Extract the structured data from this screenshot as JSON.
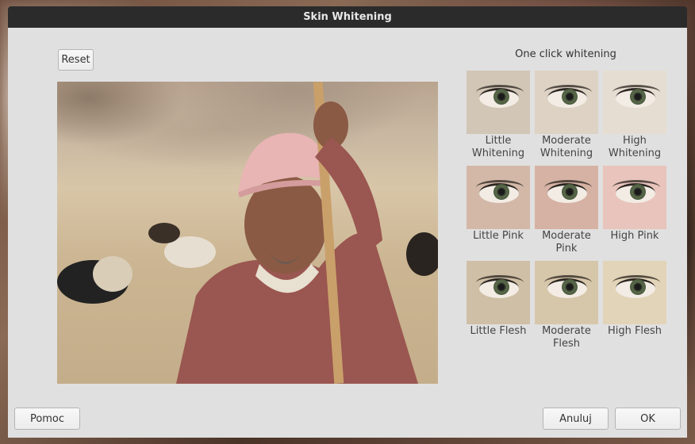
{
  "window": {
    "title": "Skin Whitening"
  },
  "toolbar": {
    "reset_label": "Reset"
  },
  "presets": {
    "title": "One click whitening",
    "items": [
      {
        "label": "Little Whitening",
        "tone": "#d2c6b6"
      },
      {
        "label": "Moderate Whitening",
        "tone": "#ddd2c4"
      },
      {
        "label": "High Whitening",
        "tone": "#e6ddd2"
      },
      {
        "label": "Little Pink",
        "tone": "#d3b8a8"
      },
      {
        "label": "Moderate Pink",
        "tone": "#d6b2a4"
      },
      {
        "label": "High Pink",
        "tone": "#e8c4bc"
      },
      {
        "label": "Little Flesh",
        "tone": "#cfbfa6"
      },
      {
        "label": "Moderate Flesh",
        "tone": "#d6c6aa"
      },
      {
        "label": "High Flesh",
        "tone": "#e2d4b8"
      }
    ]
  },
  "footer": {
    "help_label": "Pomoc",
    "cancel_label": "Anuluj",
    "ok_label": "OK"
  }
}
